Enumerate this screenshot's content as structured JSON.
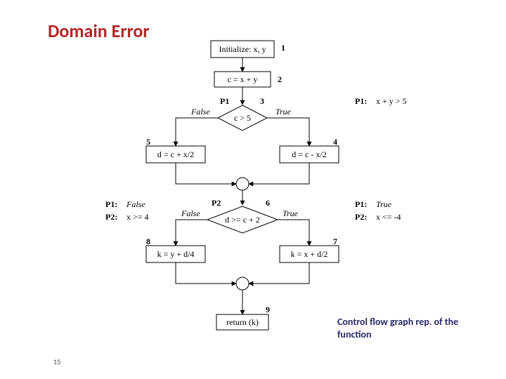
{
  "title": "Domain Error",
  "caption": "Control flow graph rep. of the function",
  "page_number": "15",
  "chart_data": {
    "type": "flowchart",
    "title": "Control flow graph rep. of the function",
    "nodes": [
      {
        "id": 1,
        "shape": "rect",
        "label": "Initialize: x, y"
      },
      {
        "id": 2,
        "shape": "rect",
        "label": "c = x + y"
      },
      {
        "id": 3,
        "shape": "diamond",
        "label": "c > 5",
        "predicate": "P1"
      },
      {
        "id": 4,
        "shape": "rect",
        "label": "d = c - x/2"
      },
      {
        "id": 5,
        "shape": "rect",
        "label": "d = c + x/2"
      },
      {
        "id": "m1",
        "shape": "merge"
      },
      {
        "id": 6,
        "shape": "diamond",
        "label": "d >= c + 2",
        "predicate": "P2"
      },
      {
        "id": 7,
        "shape": "rect",
        "label": "k = x + d/2"
      },
      {
        "id": 8,
        "shape": "rect",
        "label": "k = y + d/4"
      },
      {
        "id": "m2",
        "shape": "merge"
      },
      {
        "id": 9,
        "shape": "rect",
        "label": "return (k)"
      }
    ],
    "edges": [
      {
        "from": 1,
        "to": 2
      },
      {
        "from": 2,
        "to": 3
      },
      {
        "from": 3,
        "to": 4,
        "label": "True"
      },
      {
        "from": 3,
        "to": 5,
        "label": "False"
      },
      {
        "from": 4,
        "to": "m1"
      },
      {
        "from": 5,
        "to": "m1"
      },
      {
        "from": "m1",
        "to": 6
      },
      {
        "from": 6,
        "to": 7,
        "label": "True"
      },
      {
        "from": 6,
        "to": 8,
        "label": "False"
      },
      {
        "from": 7,
        "to": "m2"
      },
      {
        "from": 8,
        "to": "m2"
      },
      {
        "from": "m2",
        "to": 9
      }
    ],
    "annotations": [
      {
        "side": "right-top",
        "lines": [
          "P1:  x + y > 5"
        ]
      },
      {
        "side": "left",
        "lines": [
          "P1:  False",
          "P2:  x >= 4"
        ]
      },
      {
        "side": "right",
        "lines": [
          "P1:  True",
          "P2:  x <= -4"
        ]
      }
    ]
  },
  "labels": {
    "n1": "Initialize: x, y",
    "id1": "1",
    "n2": "c = x + y",
    "id2": "2",
    "p1": "P1",
    "id3": "3",
    "n3": "c > 5",
    "true": "True",
    "false": "False",
    "id4": "4",
    "n4": "d = c - x/2",
    "id5": "5",
    "n5": "d = c + x/2",
    "p2": "P2",
    "id6": "6",
    "n6": "d >= c + 2",
    "id7": "7",
    "n7": "k = x + d/2",
    "id8": "8",
    "n8": "k = y + d/4",
    "id9": "9",
    "n9": "return (k)",
    "annR1": "P1:",
    "annR1b": "x + y > 5",
    "annLa": "P1:",
    "annLa2": "False",
    "annLb": "P2:",
    "annLb2": "x >= 4",
    "annRa": "P1:",
    "annRa2": "True",
    "annRb": "P2:",
    "annRb2": "x <= -4"
  }
}
